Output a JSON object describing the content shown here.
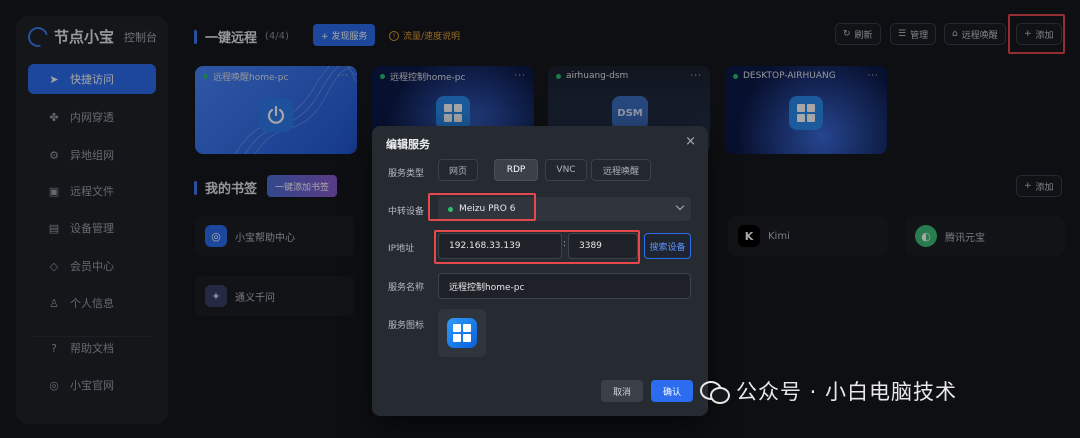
{
  "sidebar": {
    "brand": "节点小宝",
    "brand_sub": "控制台",
    "items": [
      {
        "label": "快捷访问",
        "icon": "send-icon"
      },
      {
        "label": "内网穿透",
        "icon": "fan-icon"
      },
      {
        "label": "异地组网",
        "icon": "network-icon"
      },
      {
        "label": "远程文件",
        "icon": "folder-icon"
      },
      {
        "label": "设备管理",
        "icon": "device-icon"
      },
      {
        "label": "会员中心",
        "icon": "diamond-icon"
      },
      {
        "label": "个人信息",
        "icon": "user-icon"
      },
      {
        "label": "帮助文档",
        "icon": "help-icon"
      },
      {
        "label": "小宝官网",
        "icon": "globe-icon"
      }
    ]
  },
  "remote": {
    "title": "一键远程",
    "count": "(4/4)",
    "discover_label": "+ 发现服务",
    "hint": "流量/速度说明"
  },
  "toolbar": {
    "refresh": "刷新",
    "manage": "管理",
    "wake": "远程唤醒",
    "add": "添加"
  },
  "cards": [
    {
      "name": "远程唤醒home-pc",
      "more": "···"
    },
    {
      "name": "远程控制home-pc",
      "more": "···"
    },
    {
      "name": "airhuang-dsm",
      "more": "···"
    },
    {
      "name": "DESKTOP-AIRHUANG",
      "more": "···"
    }
  ],
  "bookmarks": {
    "title": "我的书签",
    "add_bookmark": "一键添加书签",
    "add": "添加",
    "items": [
      {
        "label": "小宝帮助中心"
      },
      {
        "label": "通义千问"
      },
      {
        "label": "Kimi"
      },
      {
        "label": "腾讯元宝"
      }
    ]
  },
  "modal": {
    "title": "编辑服务",
    "close": "×",
    "type_label": "服务类型",
    "types": [
      "网页",
      "RDP",
      "VNC",
      "远程唤醒"
    ],
    "selected_type": "RDP",
    "relay_label": "中转设备",
    "relay_value": "Meizu PRO 6",
    "ip_label": "IP地址",
    "ip_value": "192.168.33.139",
    "port_sep": ":",
    "port_value": "3389",
    "search_label": "搜索设备",
    "name_label": "服务名称",
    "name_value": "远程控制home-pc",
    "icon_label": "服务图标",
    "cancel": "取消",
    "confirm": "确认"
  },
  "watermark": "公众号 · 小白电脑技术",
  "colors": {
    "accent": "#2c6df0",
    "highlight": "#e5484d",
    "online": "#2fbf71"
  }
}
